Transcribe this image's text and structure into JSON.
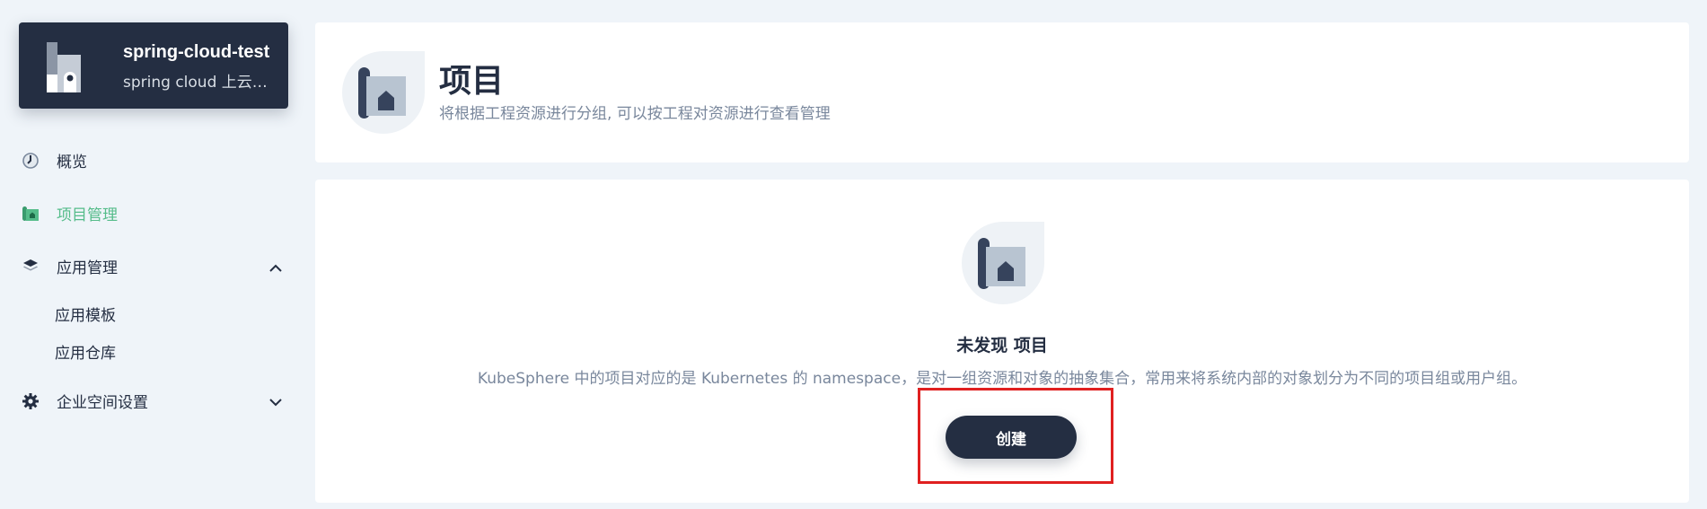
{
  "workspace": {
    "name": "spring-cloud-test",
    "description": "spring cloud 上云…"
  },
  "sidebar": {
    "items": [
      {
        "label": "概览",
        "icon": "dashboard-icon"
      },
      {
        "label": "项目管理",
        "icon": "project-icon",
        "active": true
      },
      {
        "label": "应用管理",
        "icon": "layers-icon",
        "expanded": true,
        "children": [
          {
            "label": "应用模板"
          },
          {
            "label": "应用仓库"
          }
        ]
      },
      {
        "label": "企业空间设置",
        "icon": "gear-icon",
        "expanded": false
      }
    ]
  },
  "header": {
    "title": "项目",
    "description": "将根据工程资源进行分组, 可以按工程对资源进行查看管理"
  },
  "empty_state": {
    "title": "未发现 项目",
    "description": "KubeSphere 中的项目对应的是 Kubernetes 的 namespace，是对一组资源和对象的抽象集合，常用来将系统内部的对象划分为不同的项目组或用户组。",
    "button_label": "创建"
  },
  "colors": {
    "accent": "#55bc8a",
    "dark": "#242e42",
    "background": "#eff4f9",
    "highlight": "#e02020"
  }
}
